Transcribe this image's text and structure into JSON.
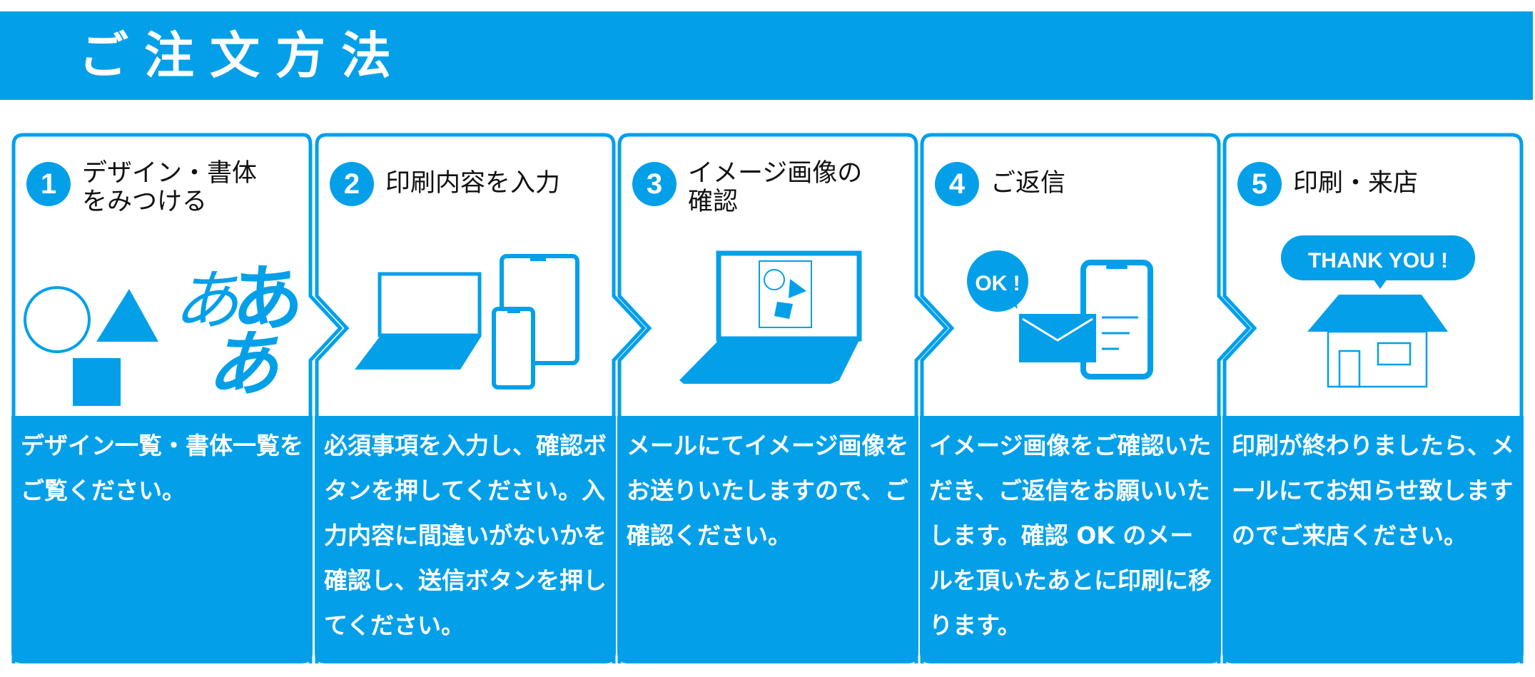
{
  "header": {
    "title": "ご注文方法"
  },
  "colors": {
    "accent": "#03A0E9",
    "text": "#111111",
    "on_accent": "#FFFFFF"
  },
  "steps": [
    {
      "number": "1",
      "title": "デザイン・書体\nをみつける",
      "illustration": "shapes-and-fonts-icon",
      "illustration_text": {
        "light": "あ",
        "bold": "あ",
        "bold2": "あ"
      },
      "description": "デザイン一覧・書体一覧をご覧ください。"
    },
    {
      "number": "2",
      "title": "印刷内容を入力",
      "illustration": "devices-icon",
      "description": "必須事項を入力し、確認ボタンを押してください。入力内容に間違いがないかを確認し、送信ボタンを押してください。"
    },
    {
      "number": "3",
      "title": "イメージ画像の\n確認",
      "illustration": "laptop-preview-icon",
      "description": "メールにてイメージ画像をお送りいたしますので、ご確認ください。"
    },
    {
      "number": "4",
      "title": "ご返信",
      "illustration": "mail-reply-icon",
      "bubble_text": "OK !",
      "description": "イメージ画像をご確認いただき、ご返信をお願いいたします。確認 OK のメールを頂いたあとに印刷に移ります。"
    },
    {
      "number": "5",
      "title": "印刷・来店",
      "illustration": "shop-icon",
      "bubble_text": "THANK YOU !",
      "description": "印刷が終わりましたら、メールにてお知らせ致しますのでご来店ください。"
    }
  ]
}
